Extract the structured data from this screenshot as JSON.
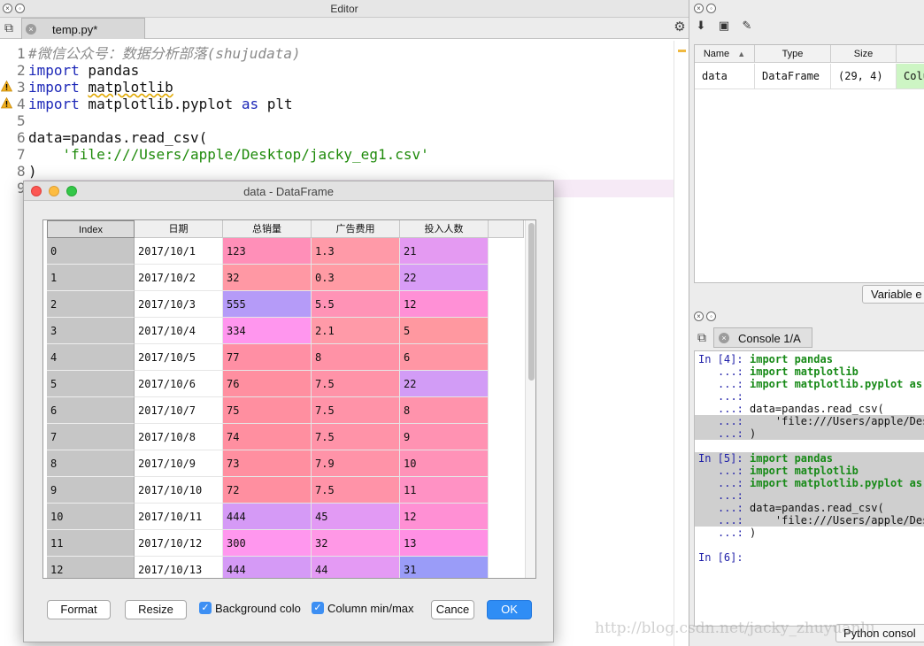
{
  "editor": {
    "title": "Editor",
    "tab_label": "temp.py*",
    "lines": [
      {
        "n": "1",
        "parts": [
          {
            "t": "#微信公众号：数据分析部落(shujudata)",
            "c": "cm"
          }
        ]
      },
      {
        "n": "2",
        "parts": [
          {
            "t": "import",
            "c": "kw"
          },
          {
            "t": " pandas",
            "c": ""
          }
        ]
      },
      {
        "n": "3",
        "warn": true,
        "parts": [
          {
            "t": "import",
            "c": "kw"
          },
          {
            "t": " ",
            "c": ""
          },
          {
            "t": "matplotlib",
            "c": "uline"
          }
        ]
      },
      {
        "n": "4",
        "warn": true,
        "parts": [
          {
            "t": "import",
            "c": "kw"
          },
          {
            "t": " matplotlib.pyplot ",
            "c": ""
          },
          {
            "t": "as",
            "c": "kw"
          },
          {
            "t": " plt",
            "c": ""
          }
        ]
      },
      {
        "n": "5",
        "parts": []
      },
      {
        "n": "6",
        "parts": [
          {
            "t": "data=pandas.read_csv(",
            "c": ""
          }
        ]
      },
      {
        "n": "7",
        "parts": [
          {
            "t": "    'file:///Users/apple/Desktop/jacky_eg1.csv'",
            "c": "st"
          }
        ]
      },
      {
        "n": "8",
        "parts": [
          {
            "t": ")",
            "c": ""
          }
        ]
      },
      {
        "n": "9",
        "parts": []
      }
    ]
  },
  "variable_explorer": {
    "headers": [
      "Name",
      "Type",
      "Size",
      ""
    ],
    "sort_indicator": "▲",
    "row": [
      "data",
      "DataFrame",
      "(29, 4)",
      "Colu"
    ],
    "tab_label": "Variable e"
  },
  "console": {
    "tab_label": "Console 1/A",
    "bottom_tab_label": "Python consol",
    "lines": [
      {
        "prompt": "In [4]:",
        "code": [
          {
            "t": "import pandas",
            "c": "ckw"
          }
        ]
      },
      {
        "cont": "...:",
        "code": [
          {
            "t": "import matplotlib",
            "c": "ckw"
          }
        ]
      },
      {
        "cont": "...:",
        "code": [
          {
            "t": "import matplotlib.pyplot as",
            "c": "ckw"
          }
        ]
      },
      {
        "cont": "...:",
        "code": []
      },
      {
        "cont": "...:",
        "code": [
          {
            "t": "data=pandas.read_csv(",
            "c": ""
          }
        ]
      },
      {
        "cont": "...:",
        "hl": true,
        "code": [
          {
            "t": "    'file:///Users/apple/Des",
            "c": ""
          }
        ]
      },
      {
        "cont": "...:",
        "hl": true,
        "code": [
          {
            "t": ")",
            "c": ""
          }
        ]
      },
      {
        "blank": true
      },
      {
        "prompt": "In [5]:",
        "hl": true,
        "code": [
          {
            "t": "import pandas",
            "c": "ckw"
          }
        ]
      },
      {
        "cont": "...:",
        "hl": true,
        "code": [
          {
            "t": "import matplotlib",
            "c": "ckw"
          }
        ]
      },
      {
        "cont": "...:",
        "hl": true,
        "code": [
          {
            "t": "import matplotlib.pyplot as",
            "c": "ckw"
          }
        ]
      },
      {
        "cont": "...:",
        "hl": true,
        "code": []
      },
      {
        "cont": "...:",
        "hl": true,
        "code": [
          {
            "t": "data=pandas.read_csv(",
            "c": ""
          }
        ]
      },
      {
        "cont": "...:",
        "hl": true,
        "code": [
          {
            "t": "    'file:///Users/apple/Des",
            "c": ""
          }
        ]
      },
      {
        "cont": "...:",
        "code": [
          {
            "t": ")",
            "c": ""
          }
        ]
      },
      {
        "blank": true
      },
      {
        "prompt": "In [6]:",
        "code": []
      }
    ]
  },
  "dataframe_dialog": {
    "title": "data - DataFrame",
    "columns": [
      "Index",
      "日期",
      "总销量",
      "广告费用",
      "投入人数"
    ],
    "rows": [
      {
        "index": "0",
        "values": [
          "2017/10/1",
          "123",
          "1.3",
          "21"
        ],
        "colors": [
          "#ff8fb8",
          "#ff9aa8",
          "#e49af2"
        ]
      },
      {
        "index": "1",
        "values": [
          "2017/10/2",
          "32",
          "0.3",
          "22"
        ],
        "colors": [
          "#ff98a4",
          "#ff9ba4",
          "#d89cf6"
        ]
      },
      {
        "index": "2",
        "values": [
          "2017/10/3",
          "555",
          "5.5",
          "12"
        ],
        "colors": [
          "#b59bf8",
          "#ff93b6",
          "#ff90d6"
        ]
      },
      {
        "index": "3",
        "values": [
          "2017/10/4",
          "334",
          "2.1",
          "5"
        ],
        "colors": [
          "#ff96ee",
          "#ff9aa8",
          "#ff98a0"
        ]
      },
      {
        "index": "4",
        "values": [
          "2017/10/5",
          "77",
          "8",
          "6"
        ],
        "colors": [
          "#ff8fa4",
          "#ff92a6",
          "#ff96a4"
        ]
      },
      {
        "index": "5",
        "values": [
          "2017/10/6",
          "76",
          "7.5",
          "22"
        ],
        "colors": [
          "#ff8fa0",
          "#ff93a8",
          "#d29cf6"
        ]
      },
      {
        "index": "6",
        "values": [
          "2017/10/7",
          "75",
          "7.5",
          "8"
        ],
        "colors": [
          "#ff8fa0",
          "#ff93a8",
          "#ff93ac"
        ]
      },
      {
        "index": "7",
        "values": [
          "2017/10/8",
          "74",
          "7.5",
          "9"
        ],
        "colors": [
          "#ff8fa0",
          "#ff93a8",
          "#ff92b2"
        ]
      },
      {
        "index": "8",
        "values": [
          "2017/10/9",
          "73",
          "7.9",
          "10"
        ],
        "colors": [
          "#ff8fa0",
          "#ff93a8",
          "#ff92b8"
        ]
      },
      {
        "index": "9",
        "values": [
          "2017/10/10",
          "72",
          "7.5",
          "11"
        ],
        "colors": [
          "#ff8fa0",
          "#ff93a8",
          "#ff92c4"
        ]
      },
      {
        "index": "10",
        "values": [
          "2017/10/11",
          "444",
          "45",
          "12"
        ],
        "colors": [
          "#d59af6",
          "#e29af4",
          "#ff90d4"
        ]
      },
      {
        "index": "11",
        "values": [
          "2017/10/12",
          "300",
          "32",
          "13"
        ],
        "colors": [
          "#ff97ee",
          "#ff98e6",
          "#ff90e4"
        ]
      },
      {
        "index": "12",
        "values": [
          "2017/10/13",
          "444",
          "44",
          "31"
        ],
        "colors": [
          "#d59af6",
          "#e49af4",
          "#9a9cf8"
        ]
      }
    ],
    "buttons": {
      "format": "Format",
      "resize": "Resize",
      "cancel": "Cance",
      "ok": "OK"
    },
    "checkboxes": {
      "background": "Background colo",
      "minmax": "Column min/max"
    }
  },
  "watermark": "http://blog.csdn.net/jacky_zhuyuanlu"
}
